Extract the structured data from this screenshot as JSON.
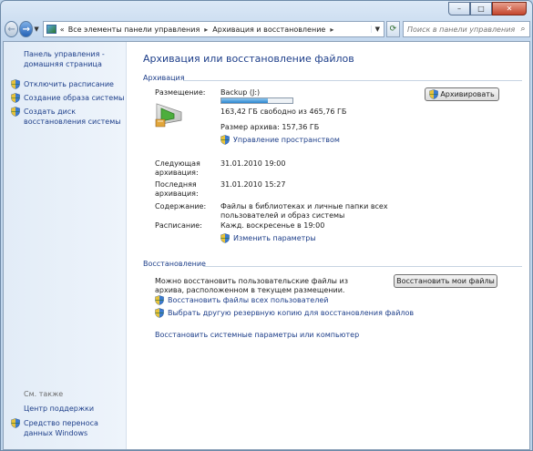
{
  "window": {
    "minimize_glyph": "–",
    "maximize_glyph": "□",
    "close_glyph": "✕"
  },
  "nav": {
    "back_icon": "back-arrow-icon",
    "forward_icon": "forward-arrow-icon",
    "chevrons": "«",
    "breadcrumb": [
      "Все элементы панели управления",
      "Архивация и восстановление"
    ],
    "search_placeholder": "Поиск в панели управления"
  },
  "sidebar": {
    "home_label": "Панель управления - домашняя страница",
    "tasks": [
      {
        "label": "Отключить расписание",
        "icon": "shield-icon"
      },
      {
        "label": "Создание образа системы",
        "icon": "shield-icon"
      },
      {
        "label": "Создать диск восстановления системы",
        "icon": "shield-icon"
      }
    ],
    "see_also": "См. также",
    "help_link": "Центр поддержки",
    "transfer_link": "Средство переноса данных Windows"
  },
  "main": {
    "title": "Архивация или восстановление файлов",
    "backup_section": "Архивация",
    "location_label": "Размещение:",
    "location_value": "Backup (J:)",
    "free_space": "163,42 ГБ свободно из 465,76 ГБ",
    "disk_used_fraction": 0.65,
    "archive_size": "Размер архива: 157,36 ГБ",
    "manage_space_link": "Управление пространством",
    "backup_button": "Архивировать",
    "next_label": "Следующая архивация:",
    "next_value": "31.01.2010 19:00",
    "last_label": "Последняя архивация:",
    "last_value": "31.01.2010 15:27",
    "contents_label": "Содержание:",
    "contents_value": "Файлы в библиотеках и личные папки всех пользователей и образ системы",
    "schedule_label": "Расписание:",
    "schedule_value": "Кажд. воскресенье в 19:00",
    "change_settings_link": "Изменить параметры",
    "restore_section": "Восстановление",
    "restore_text": "Можно восстановить пользовательские файлы из архива, расположенном в текущем размещении.",
    "restore_my_files_button": "Восстановить мои файлы",
    "restore_all_users_link": "Восстановить файлы всех пользователей",
    "select_other_backup_link": "Выбрать другую резервную копию для восстановления файлов",
    "restore_system_link": "Восстановить системные параметры или компьютер"
  }
}
